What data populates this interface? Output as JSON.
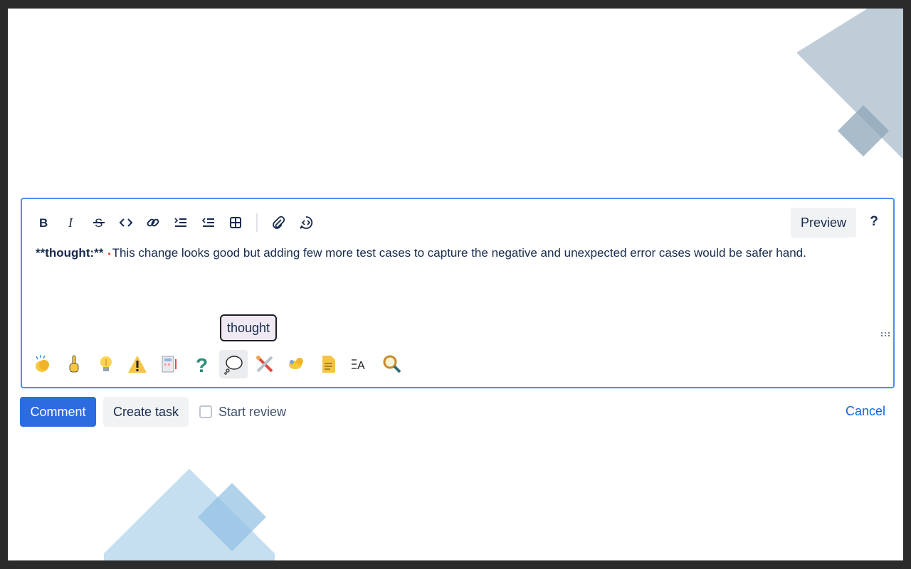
{
  "toolbar": {
    "buttons": [
      "bold",
      "italic",
      "strikethrough",
      "code",
      "link",
      "numbered-list",
      "bullet-list",
      "table",
      "attachment",
      "code-snippet"
    ],
    "preview_label": "Preview",
    "help_label": "?"
  },
  "editor": {
    "prefix": "**thought:**",
    "body": "This change looks good but adding few more test cases to capture the negative and unexpected error cases would be safer hand."
  },
  "tooltip": {
    "text": "thought"
  },
  "emoji_row": {
    "items": [
      "clapping-hands",
      "pointing-up",
      "light-bulb",
      "warning",
      "memo-calculator",
      "question-mark",
      "thought-balloon",
      "tools",
      "brain",
      "notepad",
      "text-format",
      "magnifier"
    ],
    "active": "thought-balloon"
  },
  "actions": {
    "comment_label": "Comment",
    "create_task_label": "Create task",
    "start_review_label": "Start review",
    "start_review_checked": false,
    "cancel_label": "Cancel"
  },
  "colors": {
    "accent": "#2d6be0",
    "editor_border": "#4c8ef0",
    "link": "#0c66e4",
    "deco_top": "#a9bccb",
    "deco_bottom": "#b7d6ec"
  }
}
